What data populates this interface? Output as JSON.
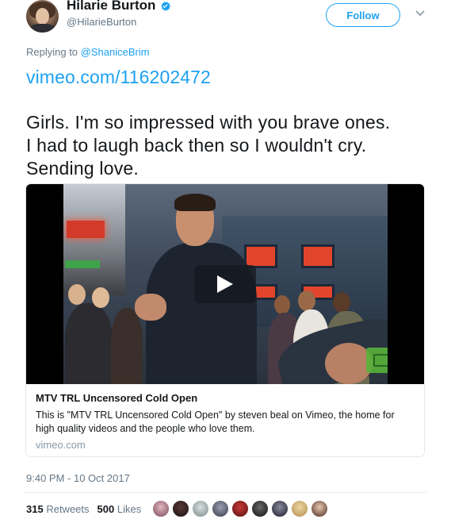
{
  "author": {
    "name": "Hilarie Burton",
    "handle": "@HilarieBurton",
    "verified_icon": "verified-badge-icon"
  },
  "actions": {
    "follow_label": "Follow",
    "more_icon": "chevron-down-icon"
  },
  "reply": {
    "prefix": "Replying to",
    "mention": "@ShaniceBrim"
  },
  "tweet": {
    "link": "vimeo.com/116202472",
    "lines": [
      "Girls. I'm so impressed with you brave ones.",
      "I had to laugh back then so I wouldn't cry.",
      "Sending love."
    ]
  },
  "card": {
    "play_icon": "play-icon",
    "title": "MTV TRL Uncensored Cold Open",
    "description_lines": [
      "This is \"MTV TRL Uncensored Cold Open\" by steven beal on Vimeo, the home for",
      "high quality videos and the people who love them."
    ],
    "domain": "vimeo.com"
  },
  "meta": {
    "timestamp": "9:40 PM - 10 Oct 2017",
    "retweets_count": "315",
    "retweets_label": "Retweets",
    "likes_count": "500",
    "likes_label": "Likes"
  },
  "colors": {
    "accent": "#1da1f2",
    "text": "#14171a",
    "muted": "#657786"
  }
}
